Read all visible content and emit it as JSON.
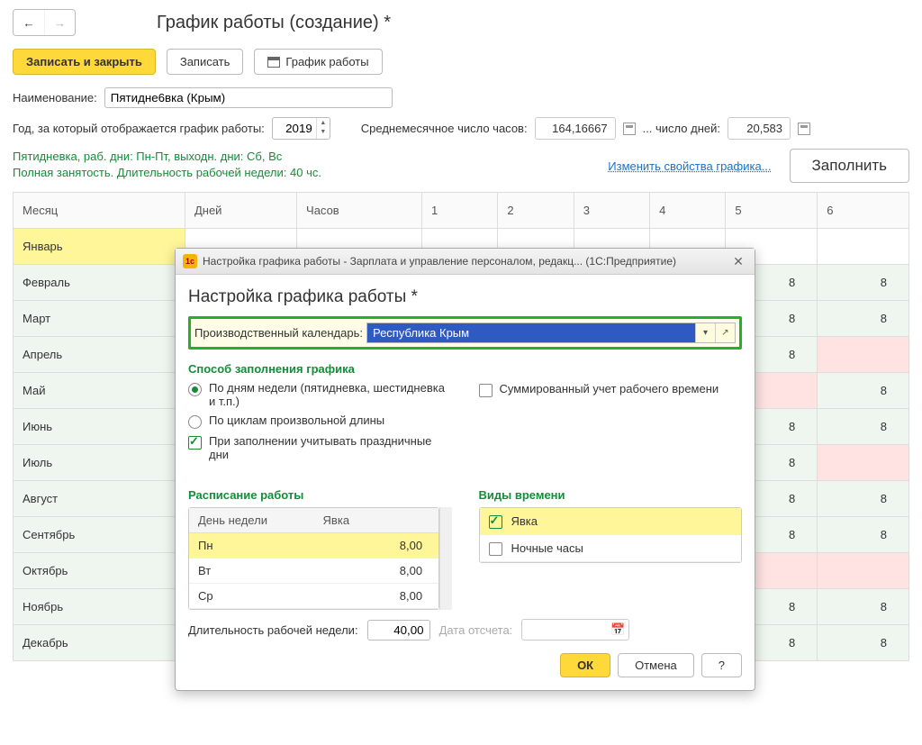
{
  "page_title": "График работы (создание) *",
  "toolbar": {
    "save_close": "Записать и закрыть",
    "save": "Записать",
    "schedule": "График работы"
  },
  "fields": {
    "name_label": "Наименование:",
    "name_value": "Пятидне6вка (Крым)",
    "year_label": "Год, за который отображается график работы:",
    "year_value": "2019",
    "avg_hours_label": "Среднемесячное число часов:",
    "avg_hours_value": "164,16667",
    "days_label": "... число дней:",
    "days_value": "20,583"
  },
  "info": {
    "line1": "Пятидневка, раб. дни: Пн-Пт, выходн. дни: Сб, Вс",
    "line2": "Полная занятость. Длительность рабочей недели: 40 чс.",
    "change_link": "Изменить свойства графика...",
    "fill_btn": "Заполнить"
  },
  "grid": {
    "headers": [
      "Месяц",
      "Дней",
      "Часов",
      "1",
      "2",
      "3",
      "4",
      "5",
      "6"
    ],
    "rows": [
      {
        "month": "Январь",
        "cells": [
          "",
          "",
          "",
          "",
          "",
          "",
          ""
        ]
      },
      {
        "month": "Февраль",
        "cells": [
          "",
          "",
          "",
          "",
          "",
          "8",
          "8"
        ]
      },
      {
        "month": "Март",
        "cells": [
          "",
          "",
          "",
          "",
          "",
          "8",
          "8"
        ]
      },
      {
        "month": "Апрель",
        "cells": [
          "",
          "",
          "",
          "",
          "",
          "8",
          ""
        ]
      },
      {
        "month": "Май",
        "cells": [
          "",
          "",
          "",
          "",
          "",
          "",
          "8"
        ]
      },
      {
        "month": "Июнь",
        "cells": [
          "",
          "",
          "",
          "",
          "",
          "8",
          "8"
        ]
      },
      {
        "month": "Июль",
        "cells": [
          "",
          "",
          "",
          "",
          "",
          "8",
          ""
        ]
      },
      {
        "month": "Август",
        "cells": [
          "",
          "",
          "",
          "",
          "",
          "8",
          "8"
        ]
      },
      {
        "month": "Сентябрь",
        "cells": [
          "",
          "",
          "",
          "",
          "",
          "8",
          "8"
        ]
      },
      {
        "month": "Октябрь",
        "cells": [
          "",
          "",
          "",
          "",
          "",
          "",
          ""
        ]
      },
      {
        "month": "Ноябрь",
        "cells": [
          "",
          "",
          "",
          "",
          "",
          "8",
          "8"
        ]
      },
      {
        "month": "Декабрь",
        "cells": [
          "",
          "",
          "",
          "",
          "",
          "8",
          "8"
        ]
      }
    ]
  },
  "modal": {
    "window_title": "Настройка графика работы - Зарплата и управление персоналом, редакц...  (1С:Предприятие)",
    "heading": "Настройка графика работы *",
    "calendar_label": "Производственный календарь:",
    "calendar_value": "Республика Крым",
    "fill_method_title": "Способ заполнения графика",
    "radio1": "По дням недели (пятидневка, шестидневка и т.п.)",
    "radio2": "По циклам произвольной длины",
    "check_holidays": "При заполнении учитывать праздничные дни",
    "sum_check": "Суммированный учет рабочего времени",
    "schedule_title": "Расписание работы",
    "sched_hdr_day": "День недели",
    "sched_hdr_att": "Явка",
    "sched_rows": [
      {
        "day": "Пн",
        "val": "8,00"
      },
      {
        "day": "Вт",
        "val": "8,00"
      },
      {
        "day": "Ср",
        "val": "8,00"
      }
    ],
    "types_title": "Виды времени",
    "type_att": "Явка",
    "type_night": "Ночные часы",
    "week_len_label": "Длительность рабочей недели:",
    "week_len_value": "40,00",
    "start_date_label": "Дата отсчета:",
    "ok": "ОК",
    "cancel": "Отмена",
    "help": "?"
  }
}
